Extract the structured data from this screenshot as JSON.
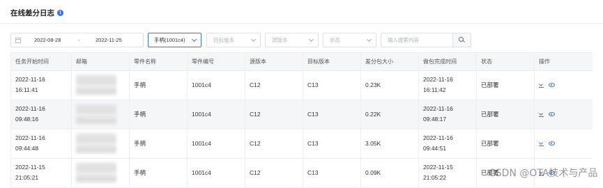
{
  "header": {
    "title": "在线差分日志",
    "info_icon": "info-icon"
  },
  "filters": {
    "date_start": "2022-08-28",
    "date_sep": "-",
    "date_end": "2022-11-25",
    "part_selected": "手柄(1001c4)",
    "target_version_placeholder": "目标版本",
    "source_version_placeholder": "源版本",
    "status_placeholder": "状态",
    "search_placeholder": "输入搜索内容"
  },
  "table": {
    "columns": [
      "任务开始时间",
      "邮箱",
      "零件名称",
      "零件编号",
      "源版本",
      "目标版本",
      "差分包大小",
      "做包完成时间",
      "状态",
      "操作"
    ],
    "rows": [
      {
        "start_time": "2022-11-16 16:11:41",
        "part_name": "手柄",
        "part_no": "1001c4",
        "source": "C12",
        "target": "C13",
        "size": "0.23K",
        "finish_time": "2022-11-16 16:11:42",
        "status": "已部署"
      },
      {
        "start_time": "2022-11-16 09:48:16",
        "part_name": "手柄",
        "part_no": "1001c4",
        "source": "C12",
        "target": "C13",
        "size": "0.22K",
        "finish_time": "2022-11-16 09:48:17",
        "status": "已部署"
      },
      {
        "start_time": "2022-11-16 09:44:48",
        "part_name": "手柄",
        "part_no": "1001c4",
        "source": "C12",
        "target": "C13",
        "size": "3.05K",
        "finish_time": "2022-11-16 09:44:51",
        "status": "已部署"
      },
      {
        "start_time": "2022-11-15 21:05:21",
        "part_name": "手柄",
        "part_no": "1001c4",
        "source": "C12",
        "target": "C13",
        "size": "0.09K",
        "finish_time": "2022-11-15 21:05:22",
        "status": "已部署"
      }
    ]
  },
  "watermark": "CSDN @OTA技术与产品",
  "colors": {
    "accent": "#3370ff",
    "header_bg": "#f5f6f8",
    "border": "#ebeef2"
  }
}
